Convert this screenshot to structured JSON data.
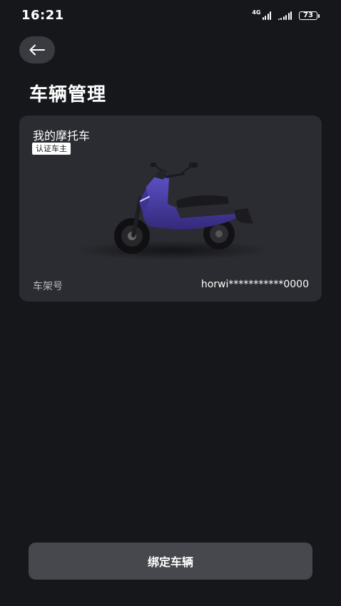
{
  "status_bar": {
    "time": "16:21",
    "network_type": "4G",
    "battery_level": "73",
    "icons": [
      "signal-4g-icon",
      "signal-icon",
      "battery-icon"
    ]
  },
  "header": {
    "back_icon": "arrow-left-icon",
    "title": "车辆管理"
  },
  "vehicle_card": {
    "name": "我的摩托车",
    "owner_badge": "认证车主",
    "frame_label": "车架号",
    "frame_value": "horwi***********0000",
    "image": "electric-scooter-image"
  },
  "footer": {
    "bind_button_label": "绑定车辆"
  },
  "colors": {
    "background": "#16171b",
    "card": "#2b2c31",
    "button": "#47484d",
    "scooter_body": "#4a3f9e"
  }
}
